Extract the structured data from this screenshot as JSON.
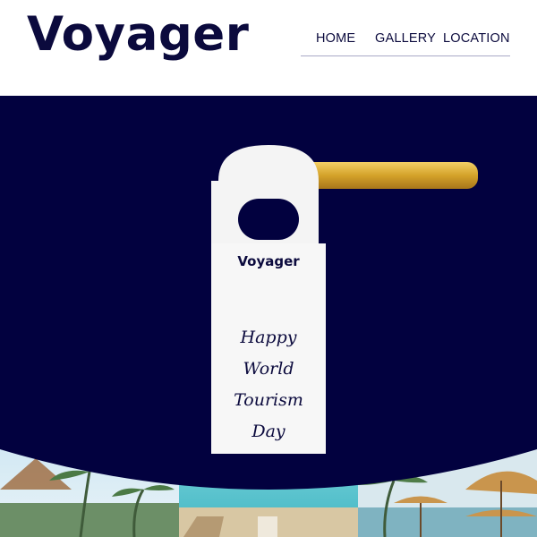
{
  "header": {
    "logo": "Voyager",
    "nav": [
      {
        "label": "HOME"
      },
      {
        "label": "GALLERY"
      },
      {
        "label": "LOCATION"
      }
    ]
  },
  "hero": {
    "hanger_brand": "Voyager",
    "hanger_lines": [
      "Happy",
      "World",
      "Tourism",
      "Day"
    ]
  },
  "colors": {
    "brand_navy": "#02013f",
    "text_navy": "#0b0a3d",
    "gold": "#d4a22a",
    "sea": "#5ec6d1",
    "sky": "#bfe0ef"
  }
}
